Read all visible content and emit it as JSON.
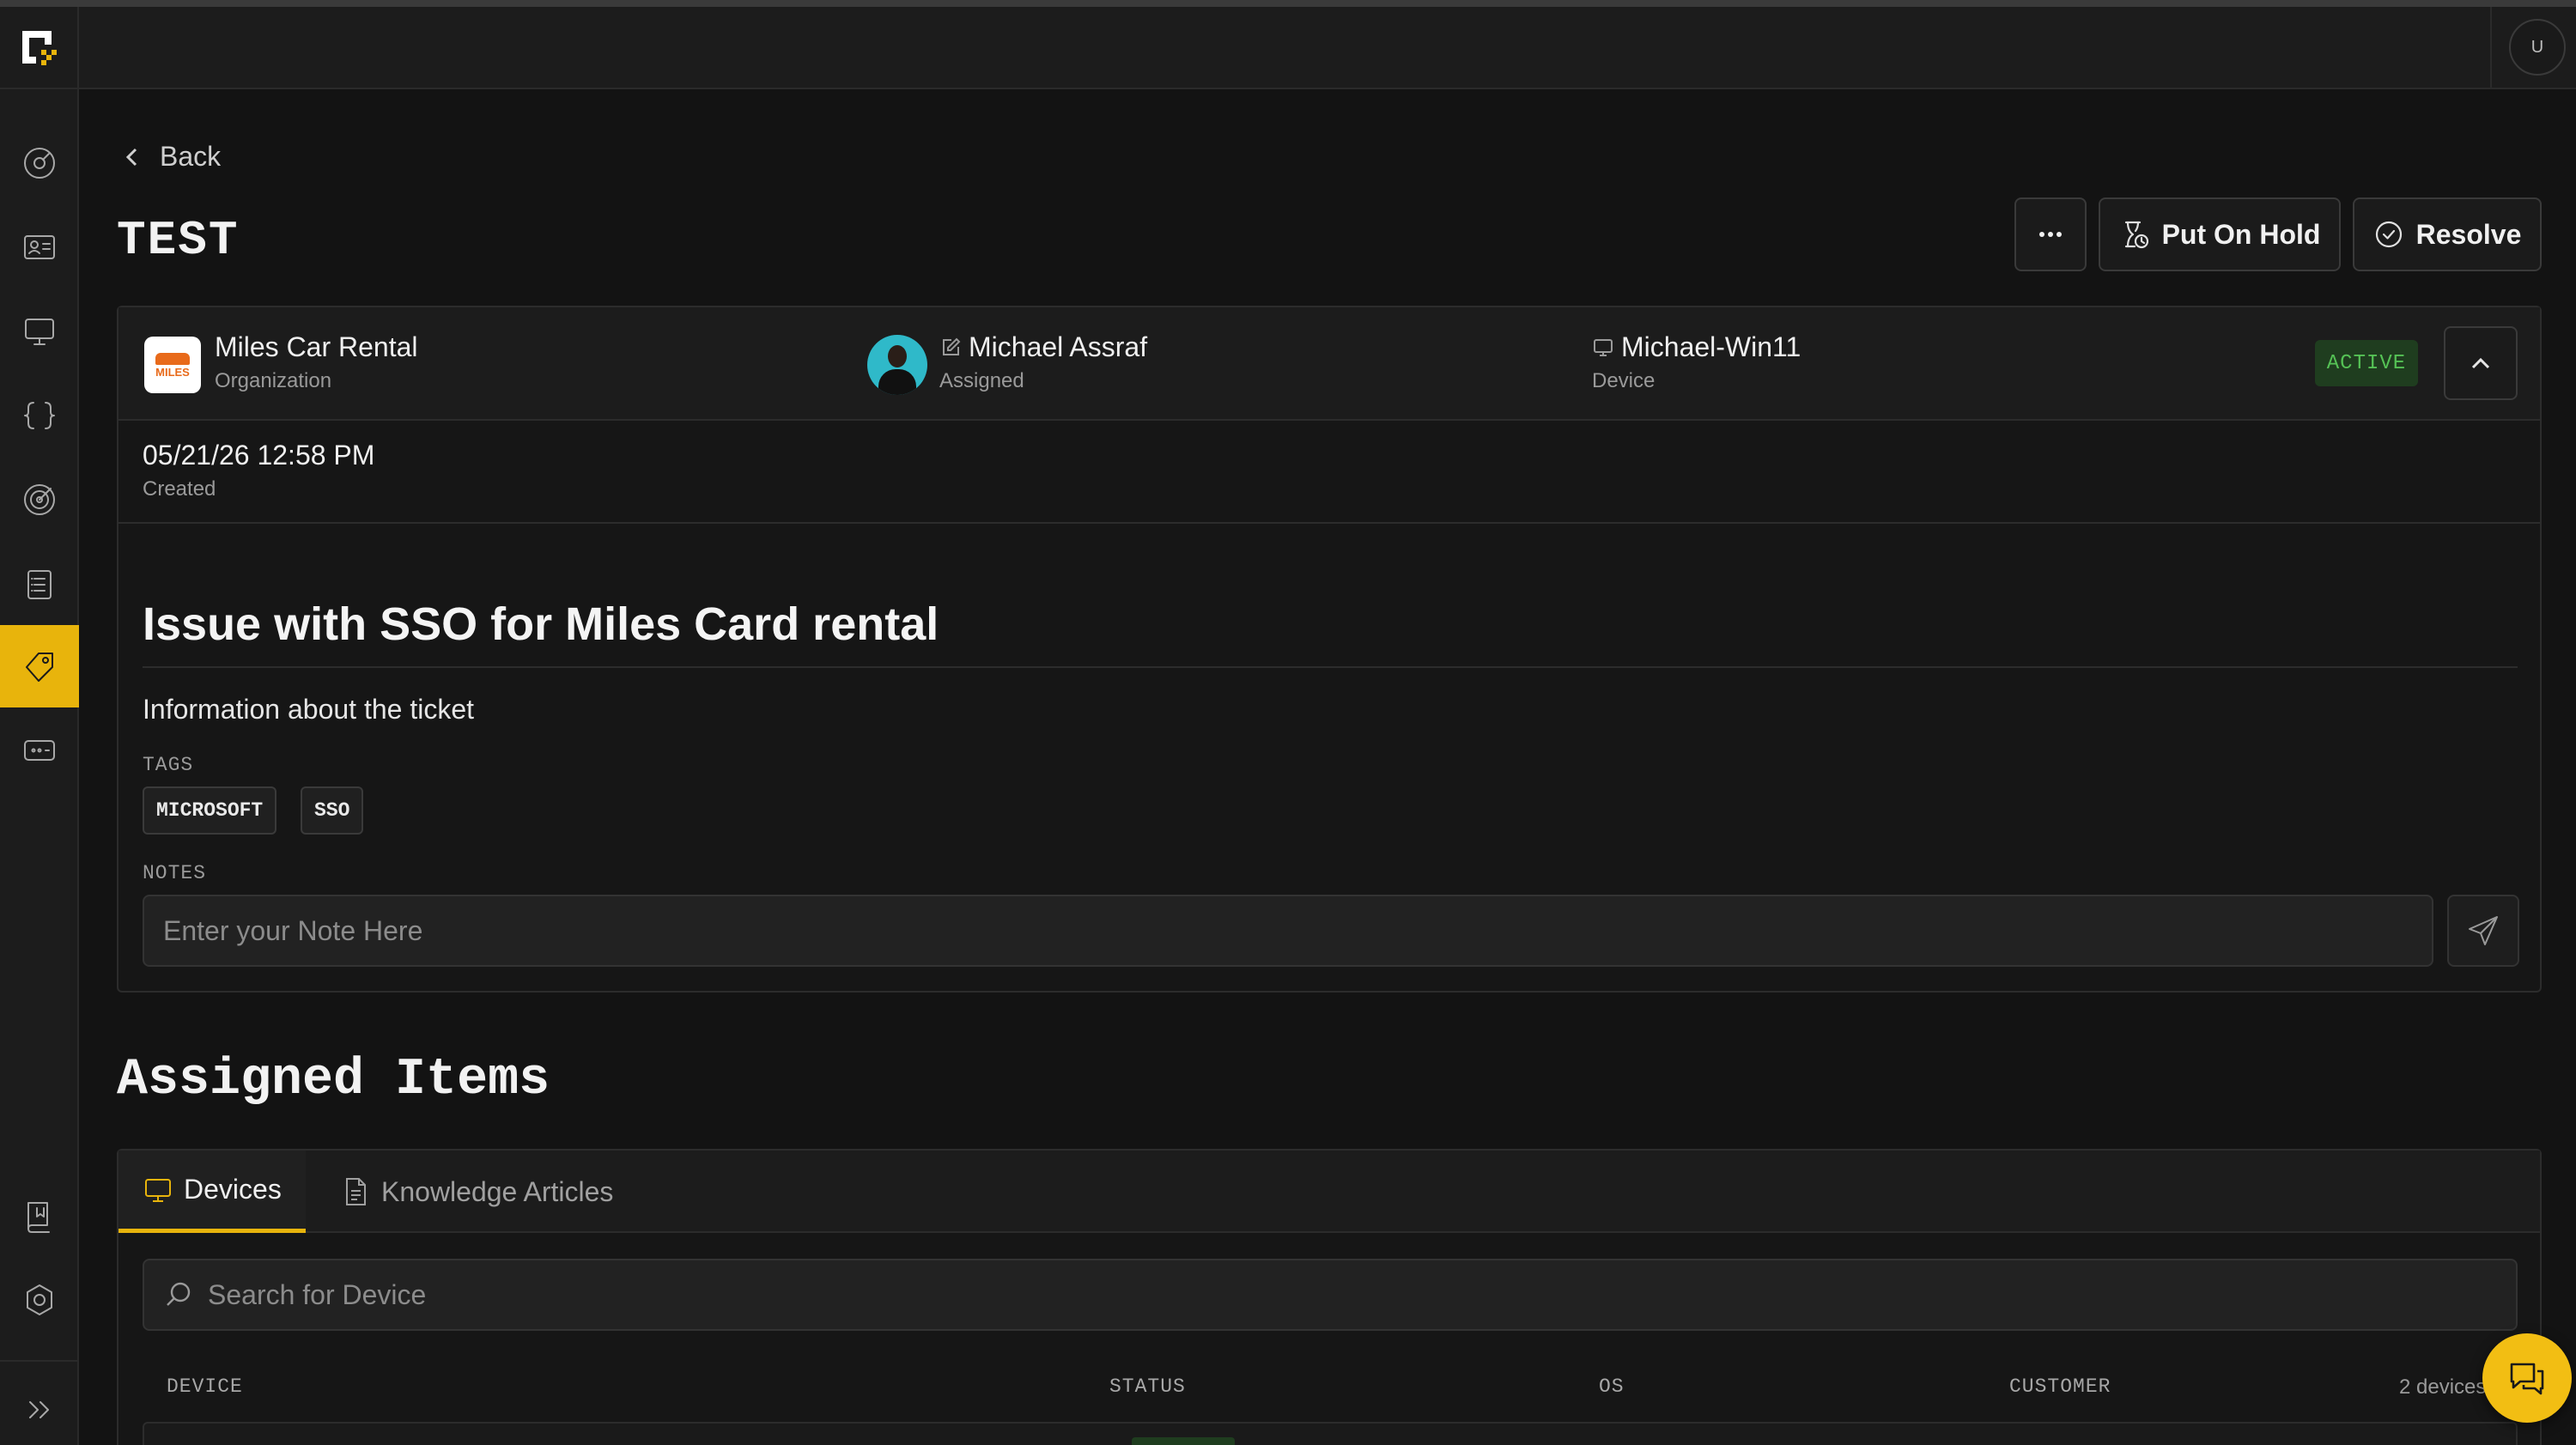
{
  "topbar": {
    "user_initial": "U"
  },
  "nav": {
    "back_label": "Back"
  },
  "ticket": {
    "title": "TEST",
    "actions": {
      "more_label": "•••",
      "hold_label": "Put On Hold",
      "resolve_label": "Resolve"
    },
    "organization": {
      "name": "Miles Car Rental",
      "label": "Organization",
      "logo_text": "MILES"
    },
    "assignee": {
      "name": "Michael Assraf",
      "label": "Assigned"
    },
    "device": {
      "name": "Michael-Win11",
      "label": "Device"
    },
    "status": "ACTIVE",
    "created": {
      "value": "05/21/26 12:58 PM",
      "label": "Created"
    },
    "issue_title": "Issue with SSO for Miles Card rental",
    "description": "Information about the ticket",
    "tags_label": "TAGS",
    "tags": [
      "MICROSOFT",
      "SSO"
    ],
    "notes_label": "NOTES",
    "notes_placeholder": "Enter your Note Here"
  },
  "assigned": {
    "title": "Assigned Items",
    "tabs": [
      {
        "label": "Devices",
        "icon": "monitor-icon",
        "active": true
      },
      {
        "label": "Knowledge Articles",
        "icon": "document-icon",
        "active": false
      }
    ],
    "search_placeholder": "Search for Device",
    "columns": [
      "DEVICE",
      "STATUS",
      "OS",
      "CUSTOMER"
    ],
    "count_label": "2 devices"
  },
  "colors": {
    "accent": "#e8b40c",
    "active_badge_bg": "#1f3d1f",
    "active_badge_text": "#55c255",
    "background": "#131313"
  }
}
